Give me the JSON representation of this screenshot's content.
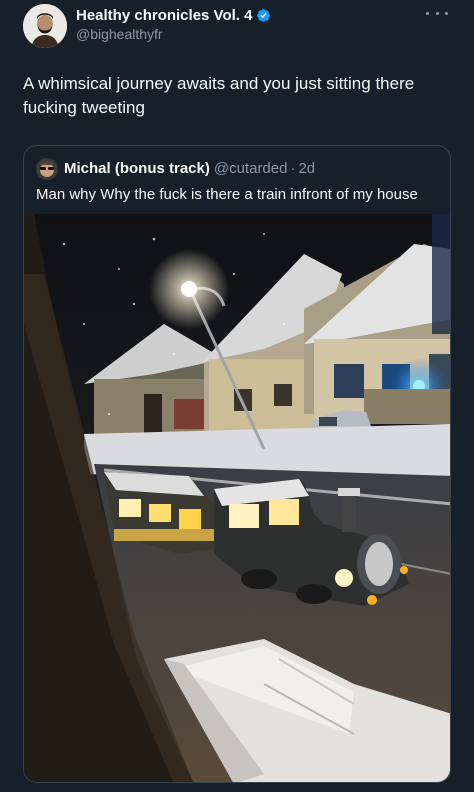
{
  "author": {
    "name": "Healthy chronicles Vol. 4",
    "handle": "@bighealthyfr",
    "avatar_icon": "profile-avatar-icon",
    "verified_icon": "verified-badge-icon",
    "verified_color": "#1d9bf0"
  },
  "tweet": {
    "text": "A whimsical journey awaits and you just sitting there fucking tweeting"
  },
  "more_icon": "more-options-icon",
  "quoted": {
    "name": "Michal (bonus track)",
    "handle": "@cutarded",
    "separator": "·",
    "time": "2d",
    "text": "Man why Why the fuck is there a train infront of my house",
    "media_icon": "photo-night-snow-street-train"
  },
  "colors": {
    "background": "#15202b",
    "text_primary": "#f7f9f9",
    "text_secondary": "#8b98a5",
    "border": "#38444d"
  }
}
